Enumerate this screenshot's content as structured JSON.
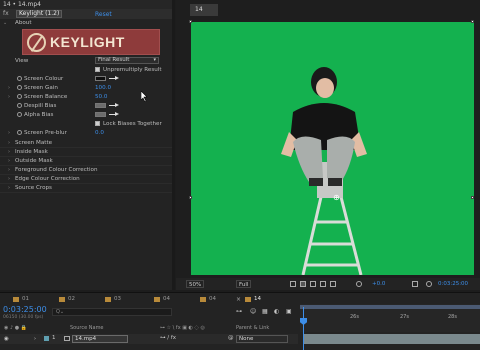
{
  "effect_panel": {
    "header": "14 • 14.mp4",
    "fx_symbol": "fx",
    "effect_name": "Keylight (1.2)",
    "reset": "Reset",
    "about": "About",
    "logo_text": "KEYLIGHT",
    "view_label": "View",
    "view_value": "Final Result",
    "unpremultiply_label": "Unpremultiply Result",
    "screen_colour_label": "Screen Colour",
    "screen_gain_label": "Screen Gain",
    "screen_gain_value": "100.0",
    "screen_balance_label": "Screen Balance",
    "screen_balance_value": "50.0",
    "despill_bias_label": "Despill Bias",
    "alpha_bias_label": "Alpha Bias",
    "lock_biases_label": "Lock Biases Together",
    "pre_blur_label": "Screen Pre-blur",
    "pre_blur_value": "0.0",
    "groups": [
      "Screen Matte",
      "Inside Mask",
      "Outside Mask",
      "Foreground Colour Correction",
      "Edge Colour Correction",
      "Source Crops"
    ],
    "colors": {
      "screen_colour": "#0f0f0f",
      "despill_bias": "#6d6d6d",
      "alpha_bias": "#6d6d6d",
      "accent": "#3d8ee8"
    }
  },
  "viewer": {
    "comp_tab": "14",
    "zoom": "50%",
    "resolution": "Full",
    "exposure": "+0.0",
    "timecode": "0:03:25:00",
    "canvas_color": "#14b14f"
  },
  "timeline": {
    "tabs": [
      "01",
      "02",
      "03",
      "04",
      "04",
      "14"
    ],
    "active_tab": "14",
    "current_time": "0:03:25:00",
    "fps_info": "06150 (30.00 fps)",
    "search_placeholder": "Q⌄",
    "col_source_name": "Source Name",
    "col_parent": "Parent & Link",
    "ruler_ticks": [
      "26s",
      "27s",
      "28s"
    ],
    "layer": {
      "number": "1",
      "name": "14.mp4",
      "parent": "None"
    }
  }
}
